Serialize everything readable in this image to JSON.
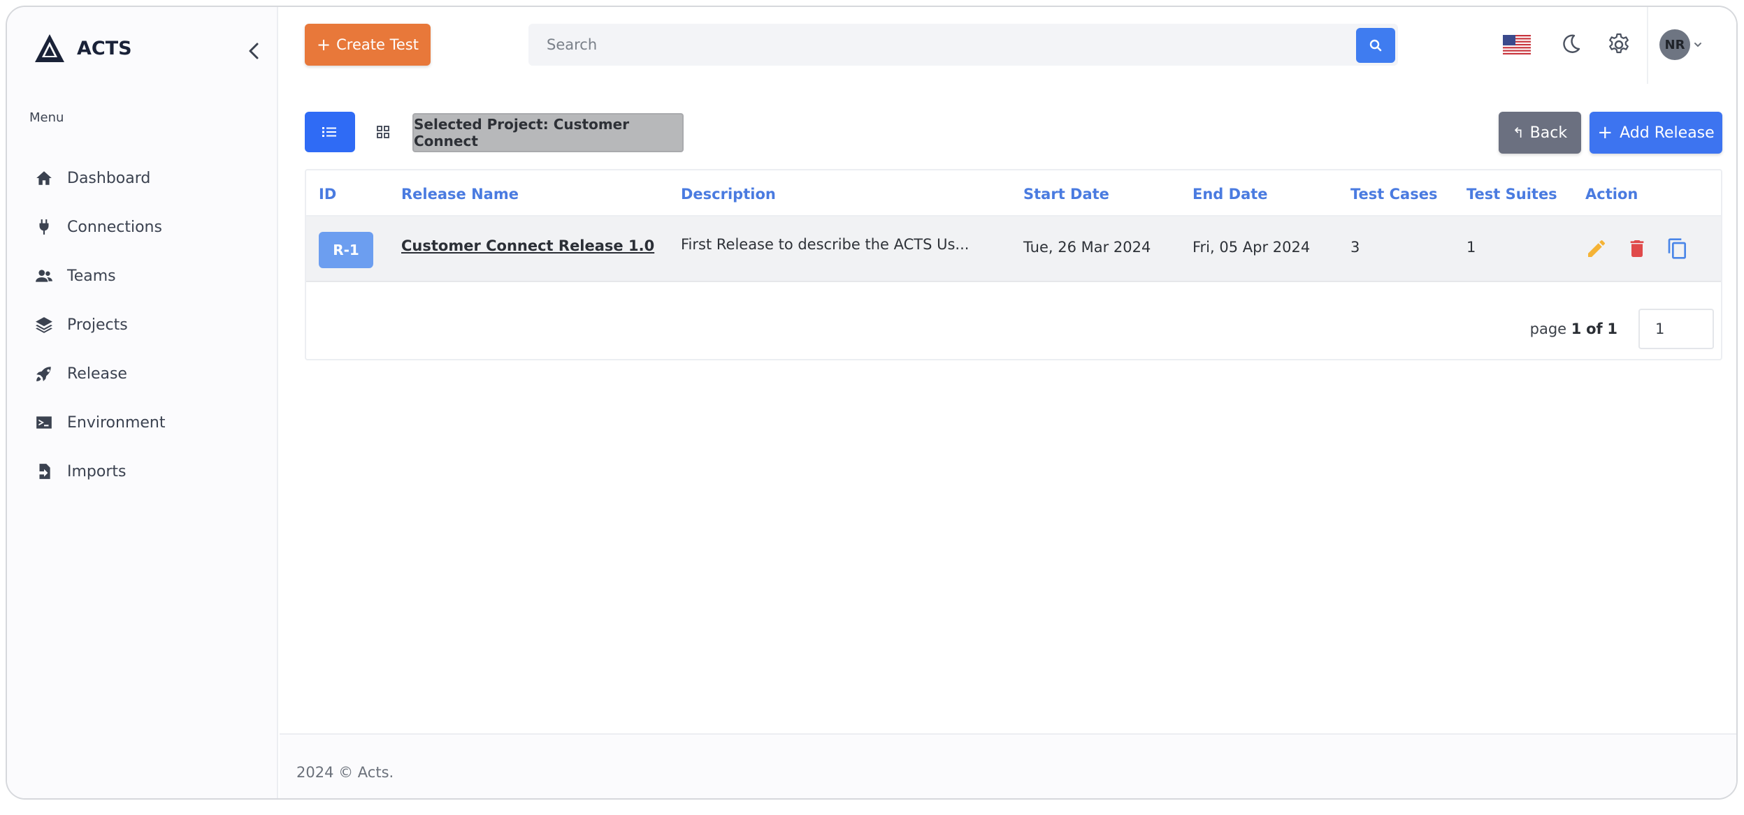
{
  "app": {
    "name": "ACTS",
    "logo_text": "ACTS"
  },
  "sidebar": {
    "menu_title": "Menu",
    "items": [
      {
        "label": "Dashboard",
        "icon": "home-icon"
      },
      {
        "label": "Connections",
        "icon": "plug-icon"
      },
      {
        "label": "Teams",
        "icon": "users-icon"
      },
      {
        "label": "Projects",
        "icon": "layers-icon"
      },
      {
        "label": "Release",
        "icon": "rocket-icon"
      },
      {
        "label": "Environment",
        "icon": "terminal-icon"
      },
      {
        "label": "Imports",
        "icon": "file-import-icon"
      }
    ]
  },
  "topbar": {
    "create_label": "Create Test",
    "search_placeholder": "Search",
    "user_initials": "NR"
  },
  "toolbar": {
    "selected_project": "Selected Project: Customer Connect",
    "back_label": "Back",
    "add_release_label": "Add Release"
  },
  "table": {
    "columns": [
      "ID",
      "Release Name",
      "Description",
      "Start Date",
      "End Date",
      "Test Cases",
      "Test Suites",
      "Action"
    ],
    "rows": [
      {
        "id": "R-1",
        "name": "Customer Connect Release 1.0",
        "description": "First Release to describe the ACTS Us...",
        "start_date": "Tue, 26 Mar 2024",
        "end_date": "Fri, 05 Apr 2024",
        "test_cases": "3",
        "test_suites": "1"
      }
    ]
  },
  "pagination": {
    "prefix": "page",
    "current": "1",
    "of": "of",
    "total": "1",
    "input_value": "1"
  },
  "footer": {
    "text": "2024 © Acts."
  },
  "colors": {
    "accent": "#3d74f0",
    "create_button": "#e8783a",
    "back_button": "#6b7080",
    "id_badge": "#6c9ef0",
    "column_header": "#4a7be0",
    "edit_icon": "#f5b335",
    "delete_icon": "#e04a4a",
    "copy_icon": "#4a86e8"
  }
}
